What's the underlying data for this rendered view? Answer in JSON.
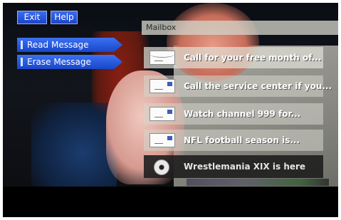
{
  "toolbar": {
    "exit_label": "Exit",
    "help_label": "Help"
  },
  "menu": {
    "items": [
      {
        "label": "Read Message"
      },
      {
        "label": "Erase Message"
      }
    ]
  },
  "mailbox": {
    "title": "Mailbox",
    "messages": [
      {
        "subject": "Call for your free month of...",
        "icon": "envelope-open-icon"
      },
      {
        "subject": "Call the service center if you...",
        "icon": "envelope-icon"
      },
      {
        "subject": "Watch channel 999 for...",
        "icon": "envelope-icon"
      },
      {
        "subject": "NFL football season is...",
        "icon": "envelope-icon"
      },
      {
        "subject": "Wrestlemania XIX is here",
        "icon": "disc-icon"
      }
    ]
  },
  "colors": {
    "button_blue": "#1b45c8",
    "panel_gray": "#d6d6cc"
  }
}
